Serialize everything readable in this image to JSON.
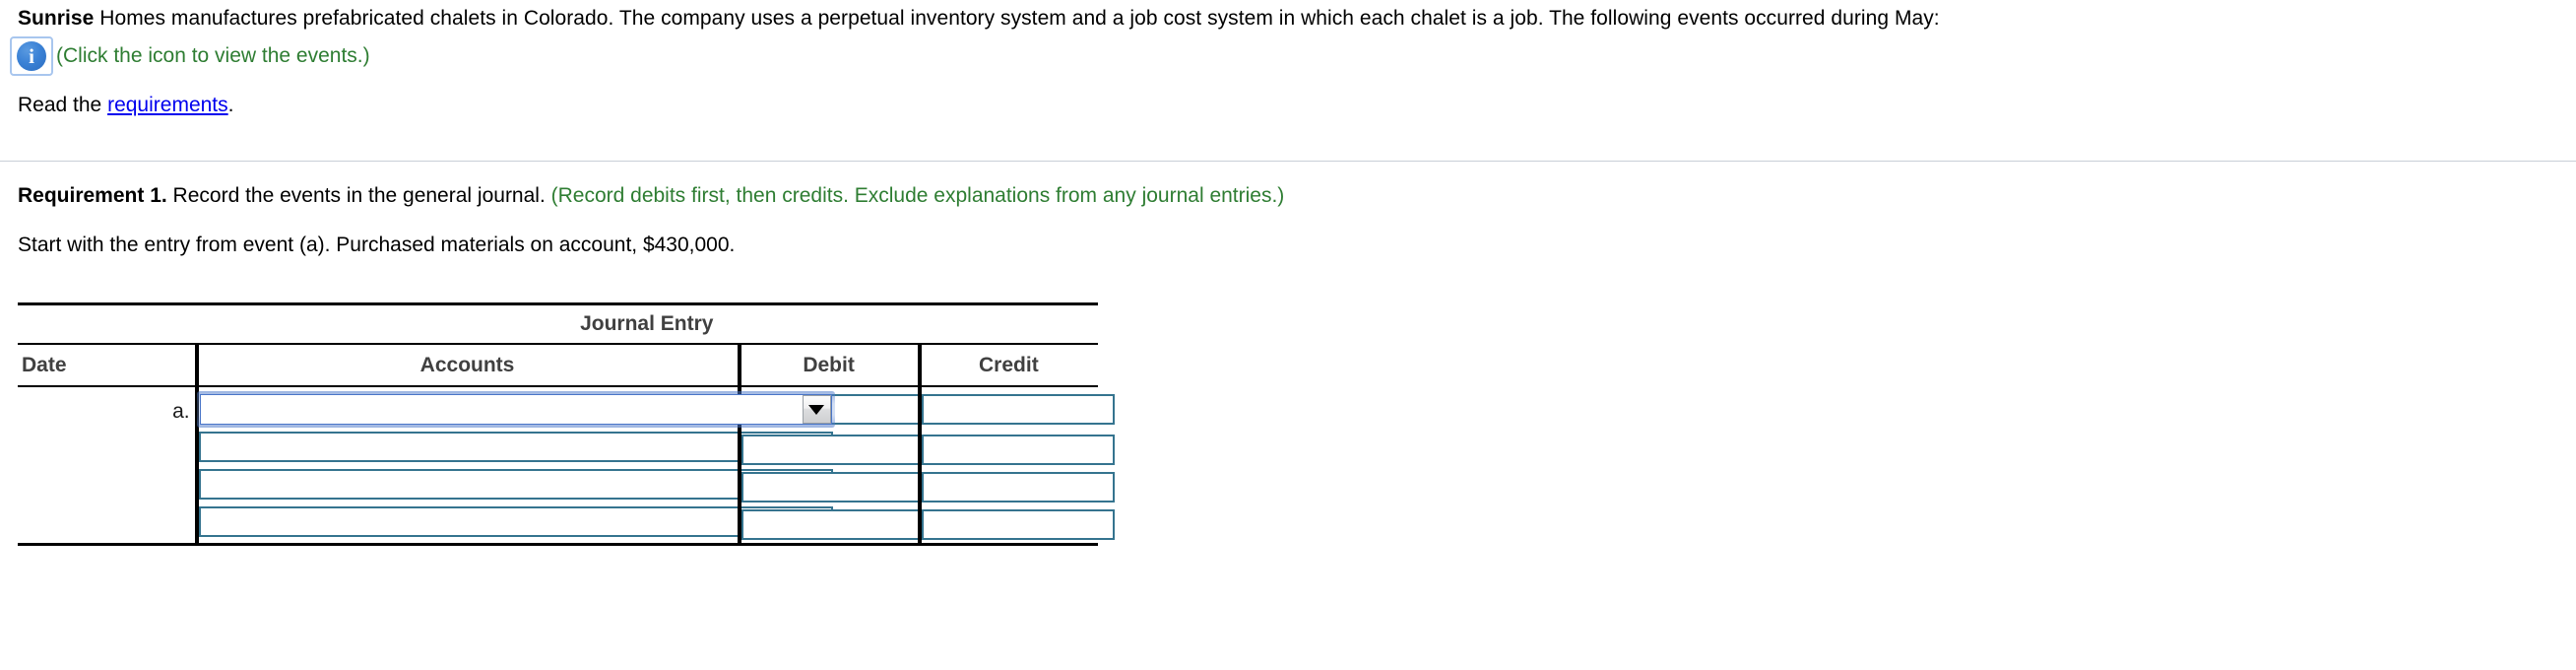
{
  "intro": {
    "company": "Sunrise",
    "sentence": " Homes manufactures prefabricated chalets in Colorado. The company uses a perpetual inventory system and a job cost system in which each chalet is a job. The following events occurred during May:",
    "icon_name": "info-icon",
    "icon_glyph": "i",
    "icon_caption": "(Click the icon to view the events.)",
    "read_prefix": "Read the ",
    "read_link": "requirements",
    "read_suffix": "."
  },
  "requirement": {
    "label": "Requirement 1.",
    "text": " Record the events in the general journal. ",
    "hint": "(Record debits first, then credits. Exclude explanations from any journal entries.)",
    "start_text": "Start with the entry from event (a). Purchased materials on account, $430,000."
  },
  "journal": {
    "title": "Journal Entry",
    "columns": [
      "Date",
      "Accounts",
      "Debit",
      "Credit"
    ],
    "row_label": "a.",
    "account_select": {
      "value": "",
      "placeholder": ""
    },
    "rows": [
      {
        "account": "",
        "debit": "",
        "credit": ""
      },
      {
        "account": "",
        "debit": "",
        "credit": ""
      },
      {
        "account": "",
        "debit": "",
        "credit": ""
      },
      {
        "account": "",
        "debit": "",
        "credit": ""
      }
    ]
  },
  "colors": {
    "hint_green": "#2e7d32",
    "link_blue": "#0000ee",
    "field_border": "#35748f",
    "focus_blue": "#4a76c8",
    "rule_gray": "#c9cfd8"
  }
}
